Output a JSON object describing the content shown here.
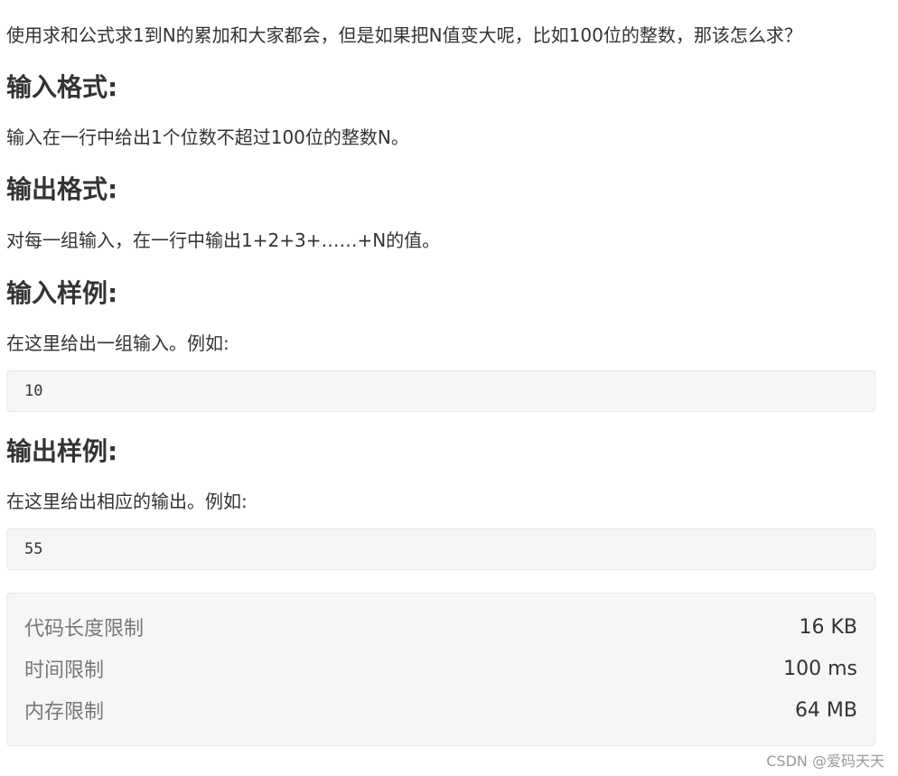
{
  "problem": {
    "description": "使用求和公式求1到N的累加和大家都会，但是如果把N值变大呢，比如100位的整数，那该怎么求？",
    "input_format": {
      "heading": "输入格式:",
      "text": "输入在一行中给出1个位数不超过100位的整数N。"
    },
    "output_format": {
      "heading": "输出格式:",
      "text": "对每一组输入，在一行中输出1+2+3+……+N的值。"
    },
    "sample_input": {
      "heading": "输入样例:",
      "text": "在这里给出一组输入。例如:",
      "code": "10"
    },
    "sample_output": {
      "heading": "输出样例:",
      "text": "在这里给出相应的输出。例如:",
      "code": "55"
    }
  },
  "limits": [
    {
      "label": "代码长度限制",
      "value": "16 KB"
    },
    {
      "label": "时间限制",
      "value": "100 ms"
    },
    {
      "label": "内存限制",
      "value": "64 MB"
    }
  ],
  "watermark": "CSDN @爱码天天"
}
